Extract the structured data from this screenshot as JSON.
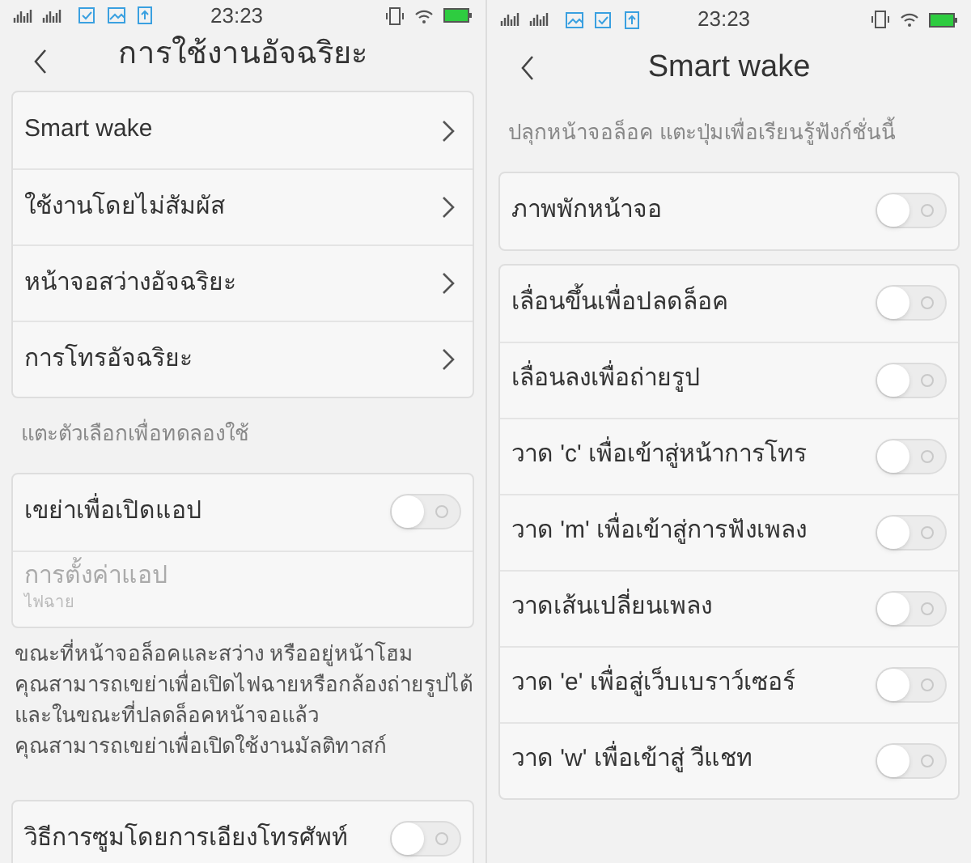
{
  "screens": [
    {
      "status_bar": {
        "time": "23:23",
        "notifications": [
          {
            "kind": "check"
          },
          {
            "kind": "picture"
          },
          {
            "kind": "upload"
          }
        ]
      },
      "title": "การใช้งานอัจฉริยะ",
      "sections": [
        {
          "kind": "card",
          "items": [
            {
              "kind": "link",
              "label": "Smart wake"
            },
            {
              "kind": "link",
              "label": "ใช้งานโดยไม่สัมผัส"
            },
            {
              "kind": "link",
              "label": "หน้าจอสว่างอัจฉริยะ"
            },
            {
              "kind": "link",
              "label": "การโทรอัจฉริยะ"
            }
          ]
        },
        {
          "kind": "label",
          "text": "แตะตัวเลือกเพื่อทดลองใช้"
        },
        {
          "kind": "card",
          "items": [
            {
              "kind": "toggle",
              "label": "เขย่าเพื่อเปิดแอป",
              "on": false
            },
            {
              "kind": "setting",
              "label": "การตั้งค่าแอป",
              "subtitle": "ไฟฉาย",
              "disabled": true
            }
          ]
        },
        {
          "kind": "paragraph",
          "lines": [
            "ขณะที่หน้าจอล็อคและสว่าง หรืออยู่หน้าโฮม",
            "คุณสามารถเขย่าเพื่อเปิดไฟฉายหรือกล้องถ่ายรูปได้",
            "และในขณะที่ปลดล็อคหน้าจอแล้ว",
            "คุณสามารถเขย่าเพื่อเปิดใช้งานมัลติทาสก์"
          ]
        },
        {
          "kind": "card",
          "items": [
            {
              "kind": "toggle",
              "label": "วิธีการซูมโดยการเอียงโทรศัพท์",
              "on": false
            }
          ]
        }
      ]
    },
    {
      "status_bar": {
        "time": "23:23",
        "notifications": [
          {
            "kind": "picture"
          },
          {
            "kind": "check"
          },
          {
            "kind": "upload"
          }
        ]
      },
      "title": "Smart wake",
      "sections": [
        {
          "kind": "label",
          "text": "ปลุกหน้าจอล็อค แตะปุ่มเพื่อเรียนรู้ฟังก์ชั่นนี้"
        },
        {
          "kind": "card",
          "items": [
            {
              "kind": "toggle",
              "label": "ภาพพักหน้าจอ",
              "on": false
            }
          ]
        },
        {
          "kind": "card",
          "items": [
            {
              "kind": "toggle",
              "label": "เลื่อนขึ้นเพื่อปลดล็อค",
              "on": false
            },
            {
              "kind": "toggle",
              "label": "เลื่อนลงเพื่อถ่ายรูป",
              "on": false
            },
            {
              "kind": "toggle",
              "label": "วาด 'c' เพื่อเข้าสู่หน้าการโทร",
              "on": false
            },
            {
              "kind": "toggle",
              "label": "วาด 'm' เพื่อเข้าสู่การฟังเพลง",
              "on": false
            },
            {
              "kind": "toggle",
              "label": "วาดเส้นเปลี่ยนเพลง",
              "on": false
            },
            {
              "kind": "toggle",
              "label": "วาด 'e' เพื่อสู่เว็บเบราว์เซอร์",
              "on": false
            },
            {
              "kind": "toggle",
              "label": "วาด 'w' เพื่อเข้าสู่ วีแชท",
              "on": false
            }
          ]
        }
      ]
    }
  ]
}
